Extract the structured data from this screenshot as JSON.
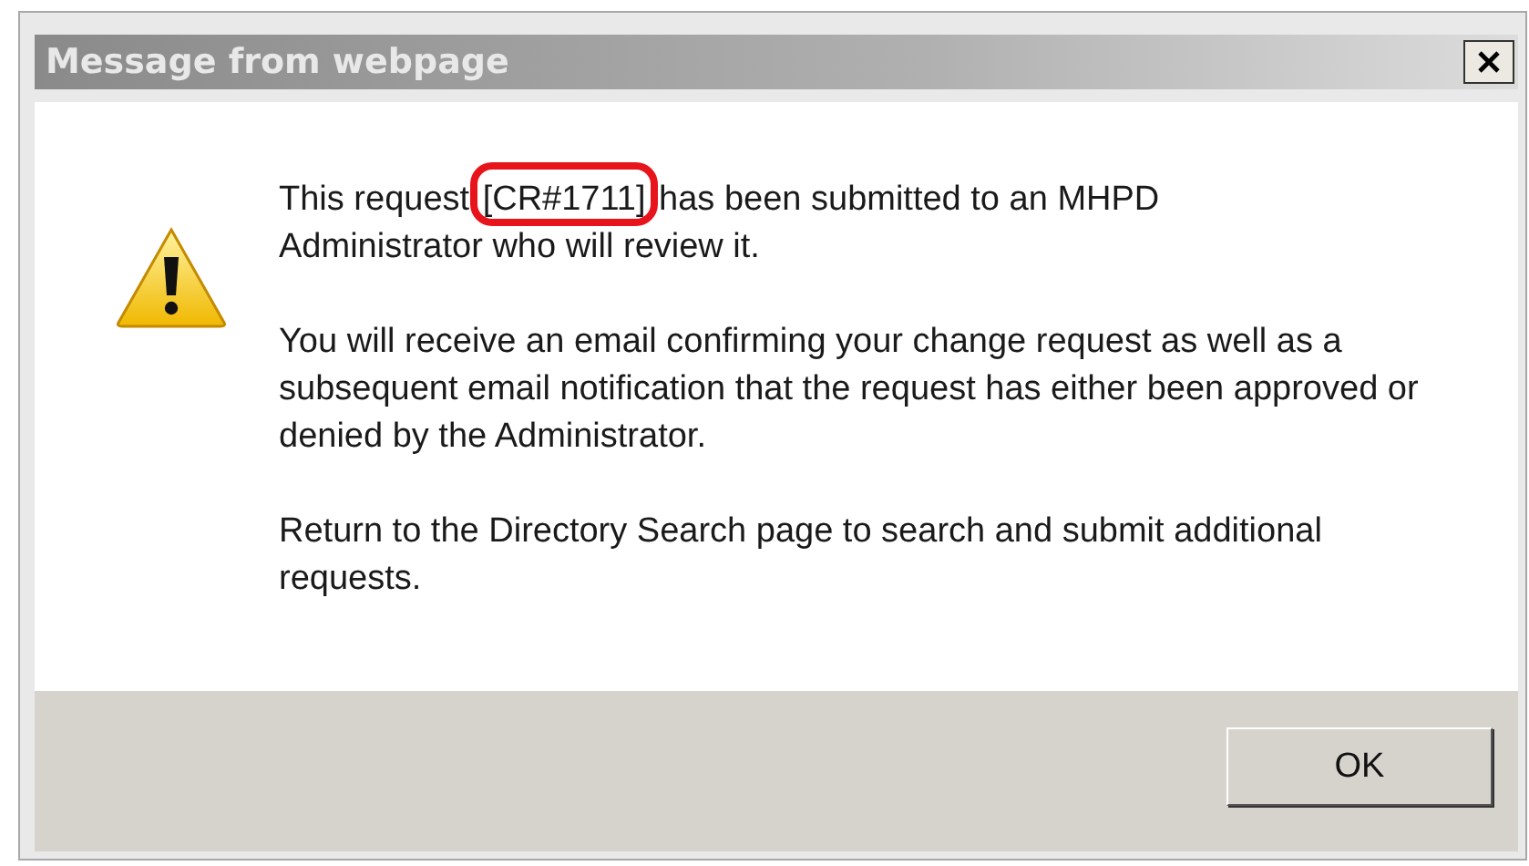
{
  "window": {
    "title": "Message from webpage"
  },
  "message": {
    "paragraphs": [
      {
        "kind": "lines",
        "lines": [
          [
            {
              "text": "This request ",
              "highlighted": false
            },
            {
              "text": "[CR#1711]",
              "highlighted": true
            },
            {
              "text": " has been submitted to an MHPD",
              "highlighted": false
            }
          ],
          [
            {
              "text": "Administrator who will review it.",
              "highlighted": false
            }
          ]
        ]
      },
      {
        "kind": "text",
        "text": "You will receive an email confirming your change request as well as a subsequent email notification that the request has either been approved or denied by the Administrator."
      },
      {
        "kind": "text",
        "text": "Return to the Directory Search page to search and submit additional requests."
      }
    ]
  },
  "buttons": [
    {
      "label": "OK"
    }
  ]
}
